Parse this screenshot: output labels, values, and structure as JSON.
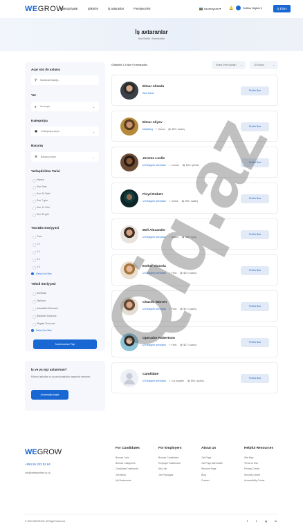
{
  "header": {
    "logo_main": "WE",
    "logo_rest": "GROW",
    "nav": [
      "Kateqoriyalar",
      "Şirkətlər",
      "İş axtaranlar",
      "Freelancerlər"
    ],
    "lang": "Azərbaycan",
    "user_name": "Softwo Digital",
    "post_button": "İş Elanı"
  },
  "banner": {
    "title": "İş axtaranlar",
    "crumbs": "Ana Səhifə  /  Namizədlər"
  },
  "sidebar": {
    "search_heading": "Açar söz ilə axtarış",
    "search_placeholder": "Namizəd başlığı...",
    "location_heading": "Yer",
    "location_value": "Yer seçin",
    "category_heading": "Kateqoriya",
    "category_value": "Kateqoriya seçin",
    "skill_heading": "Bacarıq",
    "skill_value": "Bacarıq seçin",
    "date_heading": "Yerləşdirilmə Tarixi",
    "date_options": [
      "Hamısı",
      "Son Saat",
      "Son 24 Saat",
      "Son 7 gün",
      "Son 14 Gün",
      "Son 30 gün"
    ],
    "experience_heading": "Təcrübə Səviyyəsi",
    "experience_options": [
      "Təzə",
      "1 il",
      "2 il",
      "3 il",
      "4 il"
    ],
    "experience_more": "Daha Çox Bax",
    "education_heading": "Təhsil Səviyyəsi",
    "education_options": [
      "Sertifikat",
      "Diploma",
      "Assosiativ Dərəcəsi",
      "Bakalavr Dərəcəsi",
      "Magistr Dərəcəsi"
    ],
    "education_more": "Daha Çox Bax",
    "find_button": "Namizədləri Tap"
  },
  "promo": {
    "heading": "İş və ya işçi axtarırsan?",
    "text": "Mövcud şirkətlər və ya əməkdaşlıqlar haqqında məlumat.",
    "button": "Axtarmağa başla"
  },
  "list": {
    "results_text": "Göstərilir 1-9 dən 9 namizədlər",
    "sort1": "Sırala (Yeni olanlar)",
    "sort2": "10 Göstər",
    "view_label": "Profilə Bax",
    "candidates": [
      {
        "name": "Elmar Alizada",
        "role": "Web Sitesi",
        "location": "",
        "rate": "",
        "photo": "a"
      },
      {
        "name": "Elmar Aliyev",
        "role": "Marketing",
        "location": "Gəncə",
        "rate": "$99 / saatlıq",
        "photo": "b"
      },
      {
        "name": "Jerome Leslie",
        "role": "UI Designer at Invision",
        "location": "London",
        "rate": "$45 / günlük",
        "photo": "c"
      },
      {
        "name": "Floyd Robert",
        "role": "UI Designer at Invision",
        "location": "Sevilla",
        "rate": "$99 / saatlıq",
        "photo": "d"
      },
      {
        "name": "Bell Alexander",
        "role": "UI Designer at Invision",
        "location": "Madrid",
        "rate": "$80 / aylıq",
        "photo": "e"
      },
      {
        "name": "Esther Victoria",
        "role": "UI Designer at Invision",
        "location": "Paris",
        "rate": "$64 / saatlıq",
        "photo": "f"
      },
      {
        "name": "Chastic Warren",
        "role": "UI Designer at Invision",
        "location": "Paris",
        "rate": "$91 / saatlıq",
        "photo": "g"
      },
      {
        "name": "Operador Robertson",
        "role": "UI Designer at Invision",
        "location": "Paris",
        "rate": "$87 / saatlıq",
        "photo": "h"
      },
      {
        "name": "Candidate",
        "role": "UI Designer at Invision",
        "location": "Los Angeles",
        "rate": "$56 / saatlıq",
        "photo": "none"
      }
    ]
  },
  "watermark": "Qiq.az",
  "footer": {
    "logo_main": "WE",
    "logo_rest": "GROW",
    "phone": "+994 55 323 52 64",
    "email": "info@weitspeither.co.uk",
    "col1": {
      "heading": "For Candidates",
      "links": [
        "Browse Jobs",
        "Browse Categories",
        "Candidate Dashboard",
        "Job Alerts",
        "My Bookmarks"
      ]
    },
    "col2": {
      "heading": "For Employers",
      "links": [
        "Browse Candidates",
        "Employer Dashboard",
        "Add Job",
        "Job Packages"
      ]
    },
    "col3": {
      "heading": "About Us",
      "links": [
        "Job Page",
        "Job Page Alternative",
        "Resume Page",
        "Blog",
        "Contact"
      ]
    },
    "col4": {
      "heading": "Helpful Resources",
      "links": [
        "Site Map",
        "Terms of Use",
        "Privacy Center",
        "Security Center",
        "Accessibility Center"
      ]
    },
    "copyright": "© 2023 WEGROW. All Right Reserved",
    "social": [
      "f",
      "t",
      "ig",
      "in"
    ]
  },
  "colors": {
    "accent": "#1967d2",
    "sidebar_bg": "#f5f7fc",
    "banner_bg": "#eef3fa"
  }
}
